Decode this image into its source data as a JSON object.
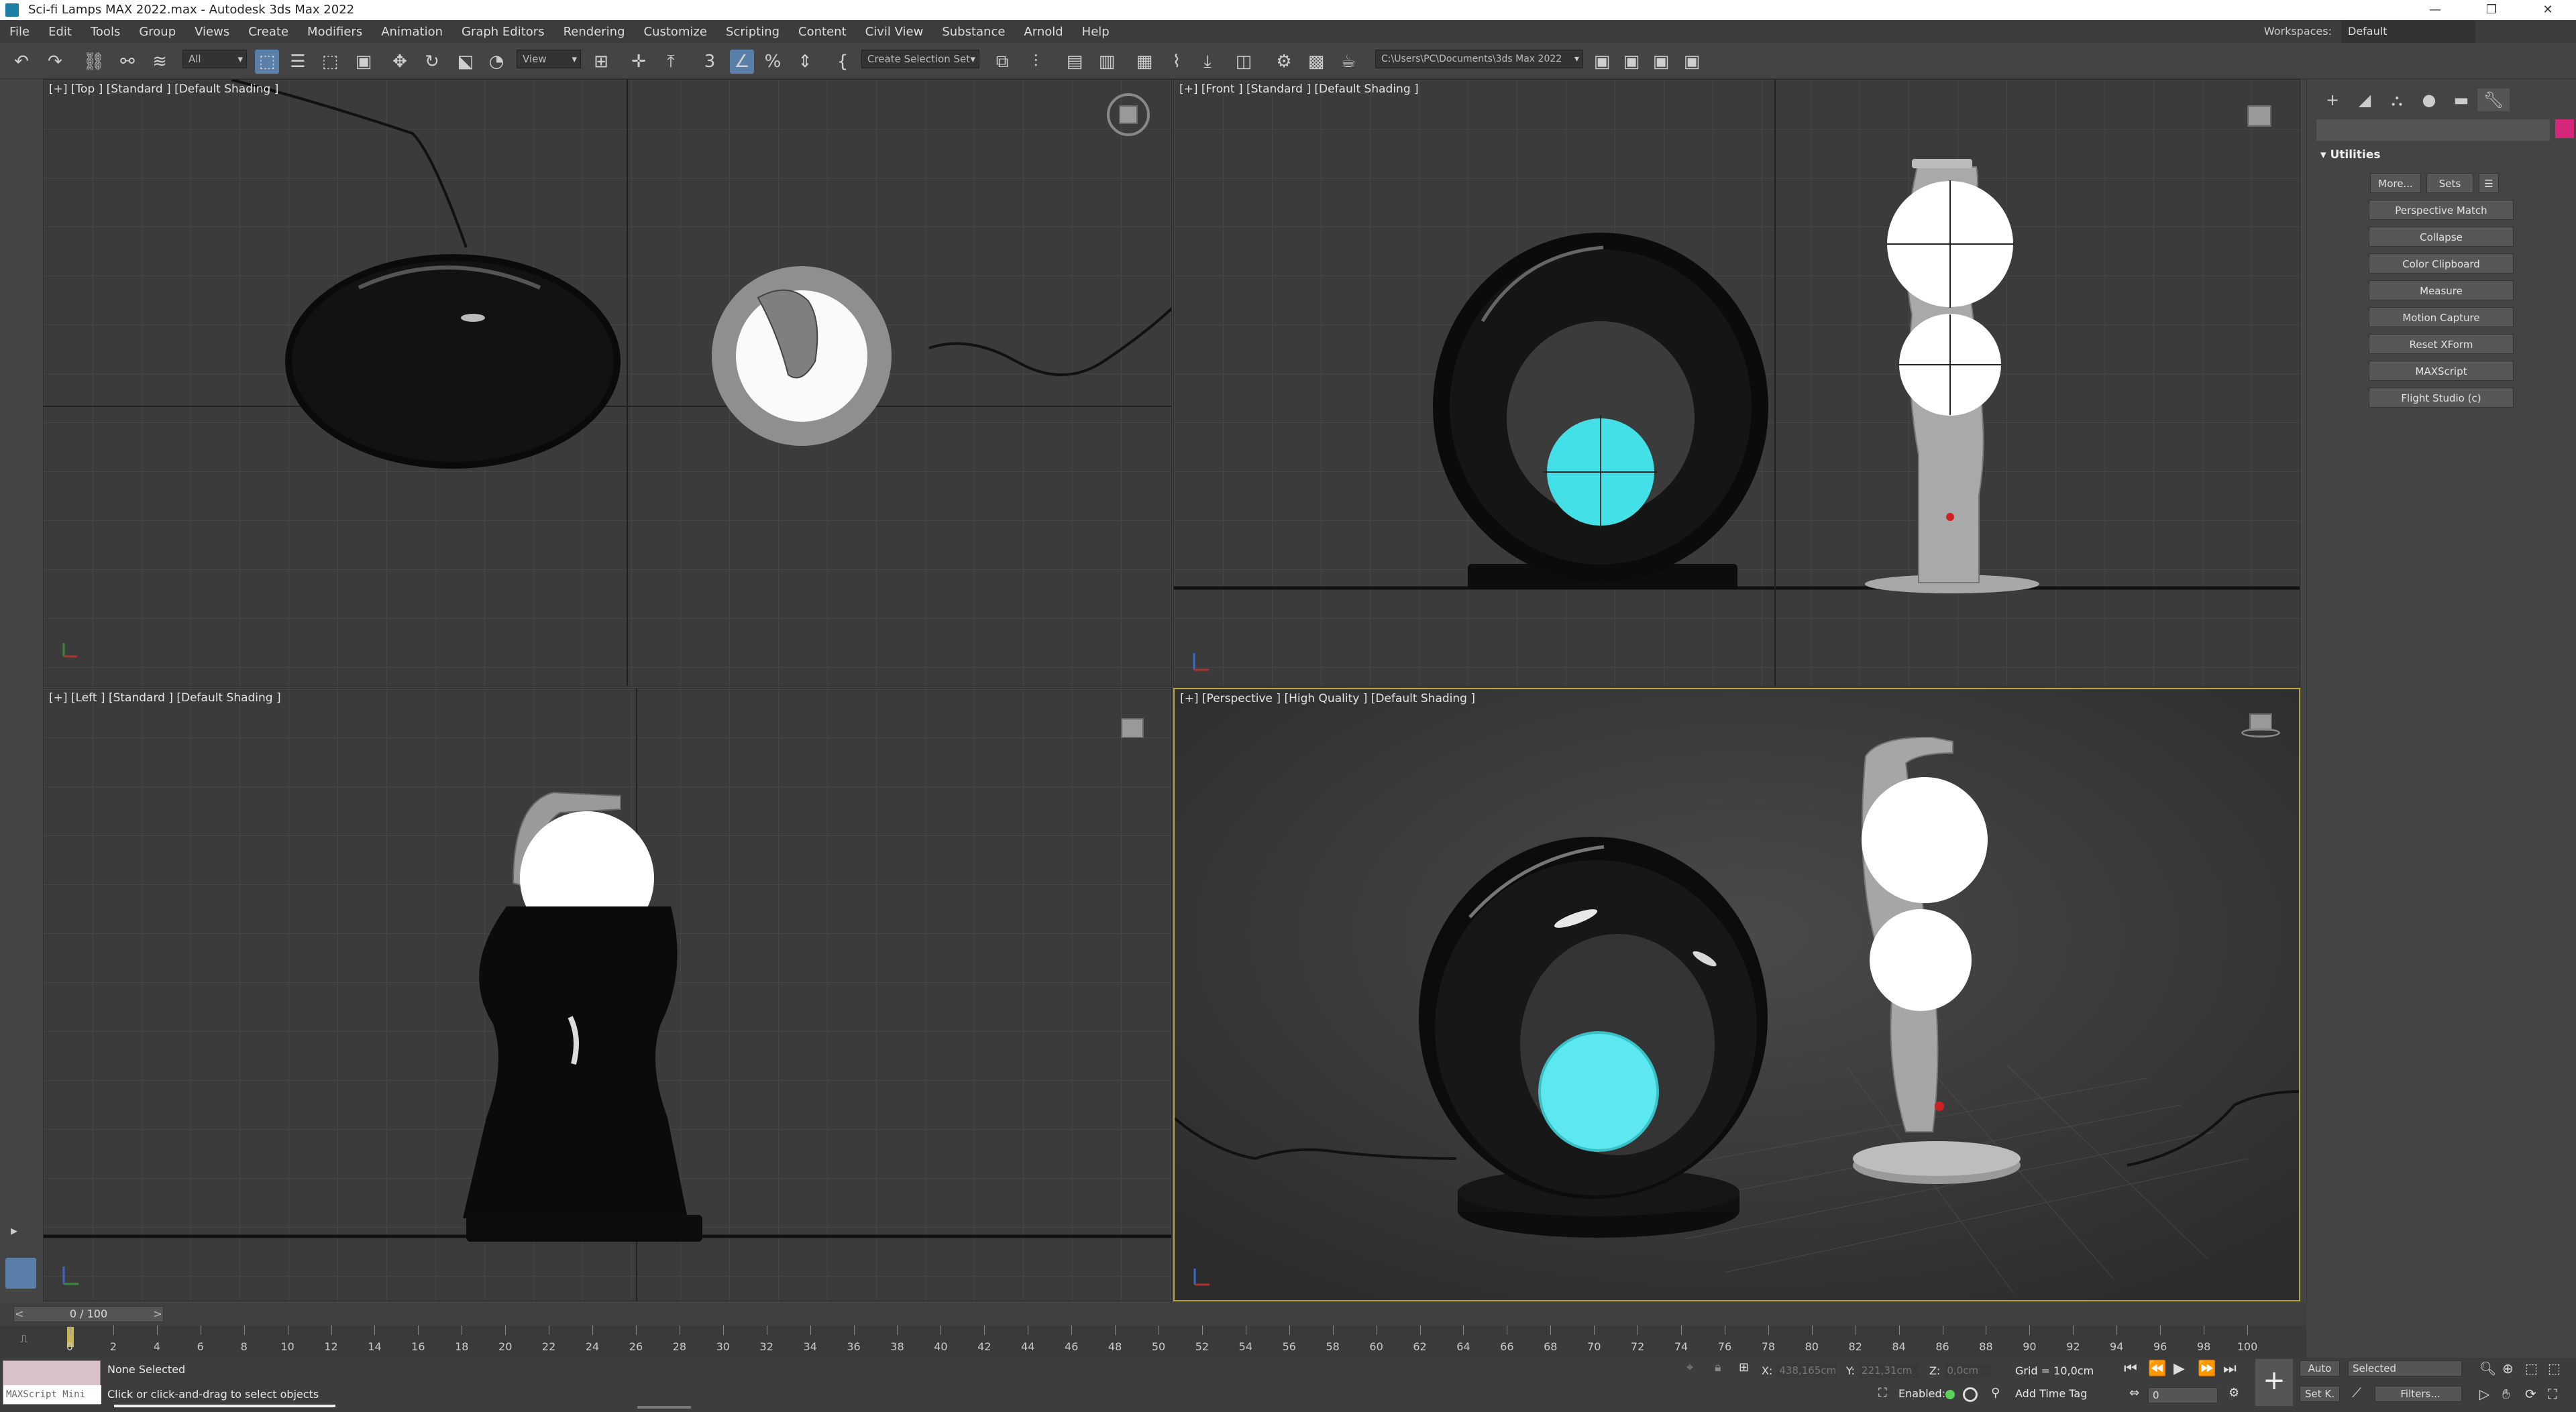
{
  "window": {
    "title": "Sci-fi Lamps MAX 2022.max - Autodesk 3ds Max 2022",
    "controls": [
      "—",
      "❐",
      "✕"
    ]
  },
  "menu": [
    "File",
    "Edit",
    "Tools",
    "Group",
    "Views",
    "Create",
    "Modifiers",
    "Animation",
    "Graph Editors",
    "Rendering",
    "Customize",
    "Scripting",
    "Content",
    "Civil View",
    "Substance",
    "Arnold",
    "Help"
  ],
  "workspaces": {
    "label": "Workspaces:",
    "value": "Default"
  },
  "toolbar": {
    "filter_value": "All",
    "refcoord_value": "View",
    "selection_set_placeholder": "Create Selection Set",
    "project_path": "C:\\Users\\PC\\Documents\\3ds Max 2022"
  },
  "viewports": {
    "top": "[+] [Top ] [Standard ] [Default Shading ]",
    "front": "[+] [Front ] [Standard ] [Default Shading ]",
    "left": "[+] [Left ] [Standard ] [Default Shading ]",
    "perspective": "[+] [Perspective ] [High Quality ] [Default Shading ]"
  },
  "command_panel": {
    "rollout_title": "Utilities",
    "more_label": "More...",
    "sets_label": "Sets",
    "utilities": [
      "Perspective Match",
      "Collapse",
      "Color Clipboard",
      "Measure",
      "Motion Capture",
      "Reset XForm",
      "MAXScript",
      "Flight Studio (c)"
    ],
    "accent_color": "#d6267a"
  },
  "timeline": {
    "frame_display": "0 / 100",
    "ticks": [
      0,
      2,
      4,
      6,
      8,
      10,
      12,
      14,
      16,
      18,
      20,
      22,
      24,
      26,
      28,
      30,
      32,
      34,
      36,
      38,
      40,
      42,
      44,
      46,
      48,
      50,
      52,
      54,
      56,
      58,
      60,
      62,
      64,
      66,
      68,
      70,
      72,
      74,
      76,
      78,
      80,
      82,
      84,
      86,
      88,
      90,
      92,
      94,
      96,
      98,
      100
    ]
  },
  "status": {
    "maxscript_placeholder": "MAXScript Mini",
    "selection": "None Selected",
    "prompt": "Click or click-and-drag to select objects",
    "x_label": "X:",
    "x_value": "438,165cm",
    "y_label": "Y:",
    "y_value": "221,31cm",
    "z_label": "Z:",
    "z_value": "0,0cm",
    "grid": "Grid = 10,0cm",
    "enabled_label": "Enabled:",
    "add_time_tag": "Add Time Tag",
    "auto_label": "Auto",
    "set_key_label": "Set K.",
    "selected_value": "Selected",
    "filters_label": "Filters...",
    "frame_value": "0"
  }
}
